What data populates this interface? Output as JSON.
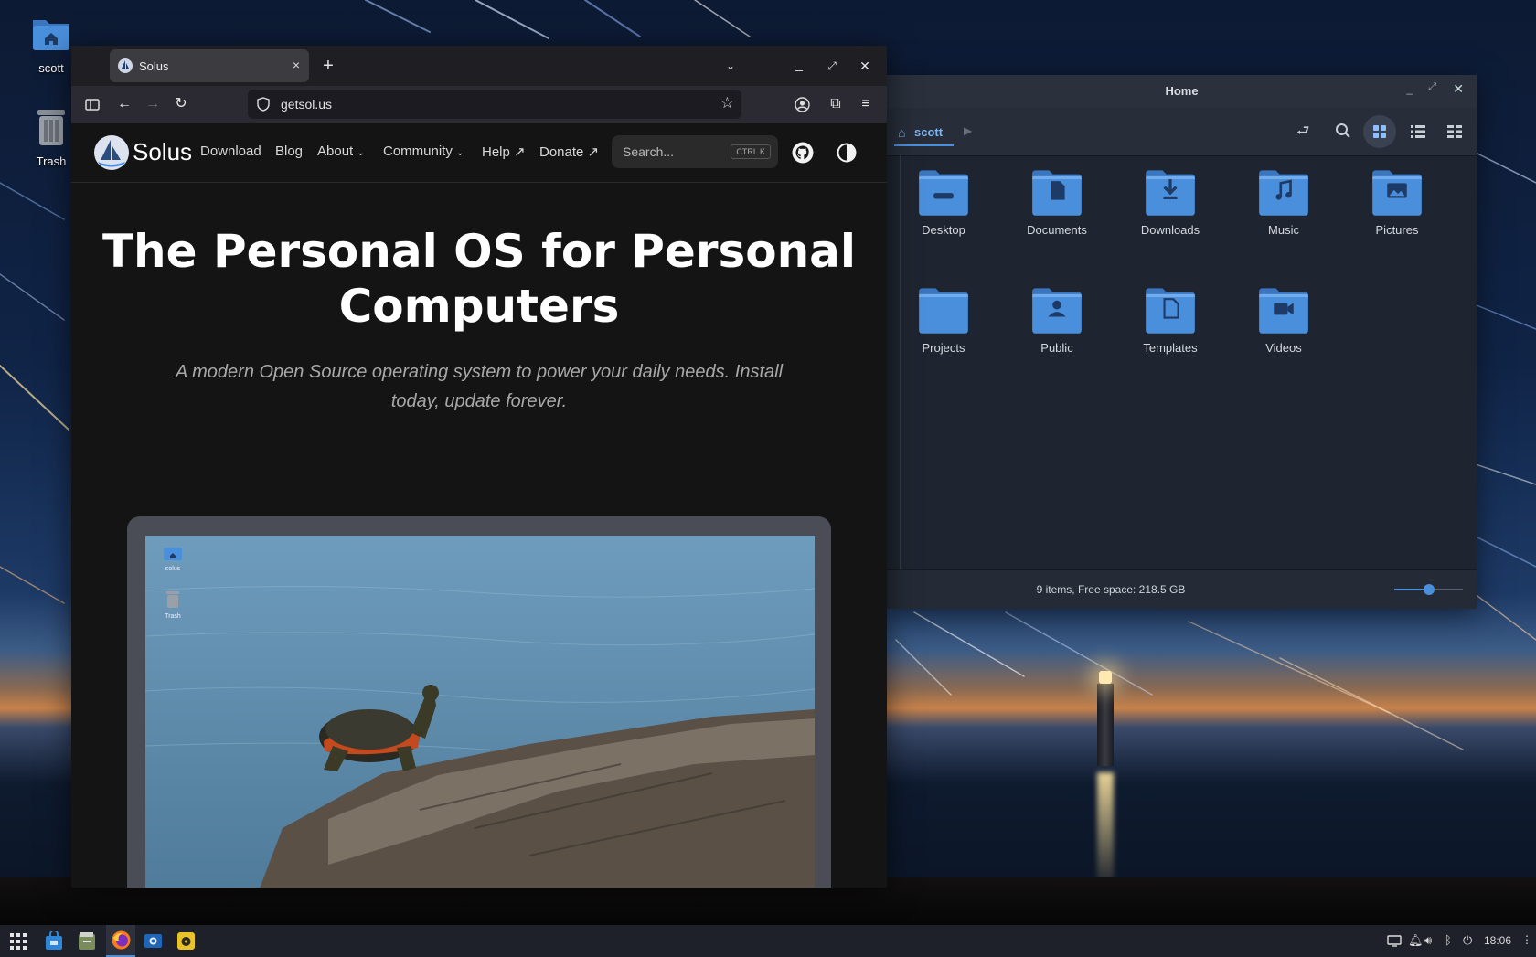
{
  "desktop": {
    "icons": [
      {
        "label": "scott",
        "icon": "home-folder-icon"
      },
      {
        "label": "Trash",
        "icon": "trash-icon"
      }
    ]
  },
  "browser": {
    "tab": {
      "title": "Solus",
      "close": "×"
    },
    "new_tab": "+",
    "url": "getsol.us",
    "site": {
      "logo": "Solus",
      "nav": {
        "download": "Download",
        "blog": "Blog",
        "about": "About",
        "community": "Community",
        "help": "Help ↗",
        "donate": "Donate ↗"
      },
      "search": {
        "placeholder": "Search...",
        "shortcut": "CTRL K"
      },
      "hero": {
        "title": "The Personal OS for Personal Computers",
        "subtitle": "A modern Open Source operating system to power your daily needs. Install today, update forever."
      },
      "preview_icons": [
        {
          "label": "solus"
        },
        {
          "label": "Trash"
        }
      ]
    }
  },
  "file_manager": {
    "title": "Home",
    "breadcrumb": "scott",
    "folders": [
      {
        "label": "Desktop",
        "icon": "desktop-folder-icon"
      },
      {
        "label": "Documents",
        "icon": "documents-folder-icon"
      },
      {
        "label": "Downloads",
        "icon": "downloads-folder-icon"
      },
      {
        "label": "Music",
        "icon": "music-folder-icon"
      },
      {
        "label": "Pictures",
        "icon": "pictures-folder-icon"
      },
      {
        "label": "Projects",
        "icon": "projects-folder-icon"
      },
      {
        "label": "Public",
        "icon": "public-folder-icon"
      },
      {
        "label": "Templates",
        "icon": "templates-folder-icon"
      },
      {
        "label": "Videos",
        "icon": "videos-folder-icon"
      }
    ],
    "status": "9 items, Free space: 218.5 GB",
    "zoom_level": 0.5
  },
  "taskbar": {
    "clock": "18:06",
    "apps": [
      "app-grid-icon",
      "software-center-icon",
      "files-icon",
      "firefox-icon",
      "screenshot-icon",
      "rhythmbox-icon"
    ]
  },
  "colors": {
    "accent": "#4a8fdc",
    "folder": "#4a8fdc",
    "folder_dark": "#3a76c0"
  }
}
